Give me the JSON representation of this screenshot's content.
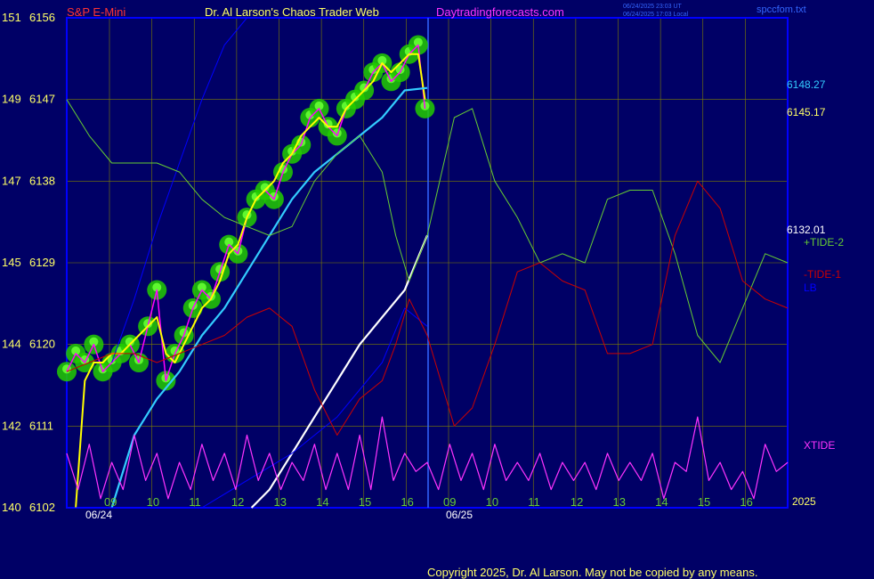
{
  "header": {
    "instrument": "S&P E-Mini",
    "title": "Dr. Al Larson's Chaos Trader Web",
    "site": "Daytradingforecasts.com",
    "timestamp_utc": "06/24/2025 23:03 UT",
    "timestamp_local": "06/24/2025 17:03 Local",
    "spec_file": "spccfom.txt"
  },
  "footer": {
    "copyright": "Copyright 2025, Dr. Al Larson. May not be copied by any means."
  },
  "colors": {
    "background": "#000066",
    "grid": "#808000",
    "price_line": "#ff00ff",
    "fast_avg": "#ffff00",
    "medium_avg": "#33ccff",
    "slow_avg": "#ffffff",
    "channel": "#0000ff",
    "tide2": "#66cc33",
    "tide1": "#cc0000",
    "xtide": "#ff33ff",
    "glow": "#22cc00"
  },
  "chart_data": {
    "type": "line",
    "title": "Dr. Al Larson's Chaos Trader Web",
    "xlabel": "",
    "ylabel": "",
    "x_tick_labels": [
      "09",
      "10",
      "11",
      "12",
      "13",
      "14",
      "15",
      "16",
      "09",
      "10",
      "11",
      "12",
      "13",
      "14",
      "15",
      "16"
    ],
    "date_labels": [
      "06/24",
      "06/25"
    ],
    "year_label": "2025",
    "y_axis_left": {
      "ticks": [
        {
          "left": "151",
          "right": "6156"
        },
        {
          "left": "149",
          "right": "6147"
        },
        {
          "left": "147",
          "right": "6138"
        },
        {
          "left": "145",
          "right": "6129"
        },
        {
          "left": "144",
          "right": "6120"
        },
        {
          "left": "142",
          "right": "6111"
        },
        {
          "left": "140",
          "right": "6102"
        }
      ],
      "ylim": [
        6102,
        6156
      ]
    },
    "right_labels": {
      "p_medium": "6148.27",
      "p_last": "6145.17",
      "p_tide": "6132.01",
      "tide2": "+TIDE-2",
      "tide1": "-TIDE-1",
      "lb": "LB",
      "xtide": "XTIDE"
    },
    "grid": true,
    "x_range": [
      0,
      16
    ],
    "series": [
      {
        "name": "S&P E-Mini",
        "key": "price",
        "x": [
          0,
          0.2,
          0.4,
          0.6,
          0.8,
          1.0,
          1.2,
          1.4,
          1.6,
          1.8,
          2.0,
          2.2,
          2.4,
          2.6,
          2.8,
          3.0,
          3.2,
          3.4,
          3.6,
          3.8,
          4.0,
          4.2,
          4.4,
          4.6,
          4.8,
          5.0,
          5.2,
          5.4,
          5.6,
          5.8,
          6.0,
          6.2,
          6.4,
          6.6,
          6.8,
          7.0,
          7.2,
          7.4,
          7.6,
          7.8,
          7.95
        ],
        "y": [
          6117,
          6119,
          6118,
          6120,
          6117,
          6118,
          6119,
          6120,
          6118,
          6122,
          6126,
          6116,
          6119,
          6121,
          6124,
          6126,
          6125,
          6128,
          6131,
          6130,
          6134,
          6136,
          6137,
          6136,
          6139,
          6141,
          6142,
          6145,
          6146,
          6144,
          6143,
          6146,
          6147,
          6148,
          6150,
          6151,
          6149,
          6150,
          6152,
          6153,
          6146
        ]
      },
      {
        "name": "",
        "key": "fast",
        "x": [
          0.2,
          0.4,
          0.6,
          0.8,
          1.0,
          1.2,
          1.4,
          1.6,
          1.8,
          2.0,
          2.2,
          2.4,
          2.6,
          2.8,
          3.0,
          3.2,
          3.4,
          3.6,
          3.8,
          4.0,
          4.2,
          4.4,
          4.6,
          4.8,
          5.0,
          5.2,
          5.4,
          5.6,
          5.8,
          6.0,
          6.2,
          6.4,
          6.6,
          6.8,
          7.0,
          7.2,
          7.4,
          7.6,
          7.8,
          7.95
        ],
        "y": [
          6102,
          6116,
          6118,
          6118,
          6119,
          6119,
          6120,
          6121,
          6122,
          6123,
          6119,
          6118,
          6120,
          6122,
          6124,
          6125,
          6127,
          6130,
          6131,
          6134,
          6136,
          6137,
          6138,
          6140,
          6141,
          6143,
          6144,
          6145,
          6144,
          6144,
          6146,
          6147,
          6148,
          6149,
          6151,
          6150,
          6151,
          6152,
          6152,
          6147
        ]
      },
      {
        "name": "",
        "key": "medium",
        "x": [
          1.0,
          1.5,
          2.0,
          2.5,
          3.0,
          3.5,
          4.0,
          4.5,
          5.0,
          5.5,
          6.0,
          6.5,
          7.0,
          7.5,
          8.0
        ],
        "y": [
          6102,
          6110,
          6114,
          6117,
          6121,
          6124,
          6128,
          6132,
          6136,
          6139,
          6141,
          6143,
          6145,
          6148,
          6148.27
        ]
      },
      {
        "name": "",
        "key": "slow",
        "x": [
          4.1,
          4.5,
          5.0,
          5.5,
          6.0,
          6.5,
          7.0,
          7.5,
          8.0
        ],
        "y": [
          6102,
          6104,
          6108,
          6112,
          6116,
          6120,
          6123,
          6126,
          6132.01
        ]
      },
      {
        "name": "",
        "key": "channel_low",
        "x": [
          0,
          1,
          2,
          3,
          4,
          5,
          6,
          7,
          7.5,
          8
        ],
        "y": [
          6090,
          6095,
          6098,
          6102,
          6105,
          6108,
          6112,
          6118,
          6124,
          6122
        ]
      },
      {
        "name": "",
        "key": "channel_high",
        "x": [
          1,
          1.5,
          2,
          2.5,
          3,
          3.5,
          4,
          4.5,
          5
        ],
        "y": [
          6118,
          6125,
          6133,
          6140,
          6147,
          6153,
          6158,
          6162,
          6165
        ]
      },
      {
        "name": "+TIDE-2",
        "key": "tide2",
        "x": [
          0,
          0.5,
          1,
          1.5,
          2,
          2.5,
          3,
          3.5,
          4,
          4.5,
          5,
          5.5,
          6,
          6.5,
          7,
          7.3,
          7.6,
          8,
          8.6,
          9,
          9.5,
          10,
          10.5,
          11,
          11.5,
          12,
          12.5,
          13,
          13.5,
          14,
          14.5,
          15,
          15.5,
          16
        ],
        "y": [
          6147,
          6143,
          6140,
          6140,
          6140,
          6139,
          6136,
          6134,
          6133,
          6132,
          6133,
          6138,
          6141,
          6143,
          6139,
          6132,
          6127,
          6132,
          6145,
          6146,
          6138,
          6134,
          6129,
          6130,
          6129,
          6136,
          6137,
          6137,
          6130,
          6121,
          6118,
          6124,
          6130,
          6129
        ]
      },
      {
        "name": "-TIDE-1",
        "key": "tide1",
        "x": [
          0,
          0.5,
          1,
          1.5,
          2,
          2.5,
          3,
          3.5,
          4,
          4.5,
          5,
          5.5,
          6,
          6.5,
          7,
          7.3,
          7.6,
          8,
          8.6,
          9,
          9.5,
          10,
          10.5,
          11,
          11.5,
          12,
          12.5,
          13,
          13.5,
          14,
          14.5,
          15,
          15.5,
          16
        ],
        "y": [
          6117,
          6118,
          6119,
          6119,
          6118,
          6119,
          6120,
          6121,
          6123,
          6124,
          6122,
          6115,
          6110,
          6114,
          6116,
          6120,
          6125,
          6121,
          6111,
          6113,
          6120,
          6128,
          6129,
          6127,
          6126,
          6119,
          6119,
          6120,
          6132,
          6138,
          6135,
          6127,
          6125,
          6124
        ]
      },
      {
        "name": "XTIDE",
        "key": "xtide",
        "x": [
          0,
          0.25,
          0.5,
          0.75,
          1,
          1.25,
          1.5,
          1.75,
          2,
          2.25,
          2.5,
          2.75,
          3,
          3.25,
          3.5,
          3.75,
          4,
          4.25,
          4.5,
          4.75,
          5,
          5.25,
          5.5,
          5.75,
          6,
          6.25,
          6.5,
          6.75,
          7,
          7.25,
          7.5,
          7.75,
          8,
          8.25,
          8.5,
          8.75,
          9,
          9.25,
          9.5,
          9.75,
          10,
          10.25,
          10.5,
          10.75,
          11,
          11.25,
          11.5,
          11.75,
          12,
          12.25,
          12.5,
          12.75,
          13,
          13.25,
          13.5,
          13.75,
          14,
          14.25,
          14.5,
          14.75,
          15,
          15.25,
          15.5,
          15.75,
          16
        ],
        "y": [
          6108,
          6104,
          6109,
          6103,
          6107,
          6104,
          6110,
          6105,
          6108,
          6103,
          6107,
          6104,
          6109,
          6105,
          6108,
          6104,
          6110,
          6105,
          6108,
          6104,
          6107,
          6105,
          6109,
          6104,
          6108,
          6104,
          6110,
          6104,
          6112,
          6105,
          6108,
          6106,
          6107,
          6104,
          6109,
          6105,
          6108,
          6104,
          6109,
          6105,
          6107,
          6105,
          6108,
          6104,
          6107,
          6105,
          6107,
          6104,
          6108,
          6105,
          6107,
          6105,
          6108,
          6103,
          6107,
          6106,
          6112,
          6105,
          6107,
          6104,
          6106,
          6103,
          6109,
          6106,
          6107
        ]
      }
    ]
  }
}
